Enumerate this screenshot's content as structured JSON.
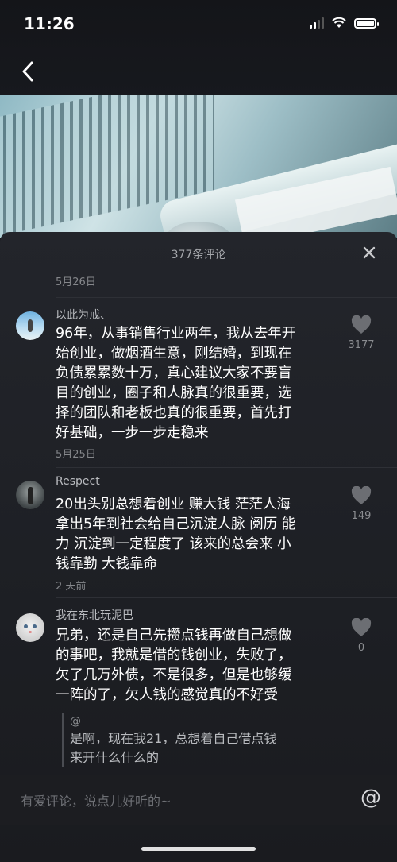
{
  "status_bar": {
    "time": "11:26"
  },
  "sheet": {
    "title": "377条评论",
    "top_date": "5月26日"
  },
  "comments": [
    {
      "name": "以此为戒、",
      "text": "96年，从事销售行业两年，我从去年开\n始创业，做烟酒生意，刚结婚，到现在\n负债累累数十万，真心建议大家不要盲\n目的创业，圈子和人脉真的很重要，选\n择的团队和老板也真的很重要，首先打\n好基础，一步一步走稳来",
      "date": "5月25日",
      "likes": "3177"
    },
    {
      "name": "Respect",
      "text": "20出头别总想着创业 赚大钱 茫茫人海\n拿出5年到社会给自己沉淀人脉 阅历 能\n力 沉淀到一定程度了 该来的总会来 小\n钱靠勤 大钱靠命",
      "date": "2 天前",
      "likes": "149"
    },
    {
      "name": "我在东北玩泥巴",
      "text": "兄弟，还是自己先攒点钱再做自己想做\n的事吧，我就是借的钱创业，失败了，\n欠了几万外债，不是很多，但是也够缓\n一阵的了，欠人钱的感觉真的不好受",
      "likes": "0",
      "reply": {
        "at": "@",
        "text": "是啊，现在我21，总想着自己借点钱\n来开什么什么的"
      }
    }
  ],
  "input": {
    "placeholder": "有爱评论，说点儿好听的~",
    "at_label": "@"
  }
}
